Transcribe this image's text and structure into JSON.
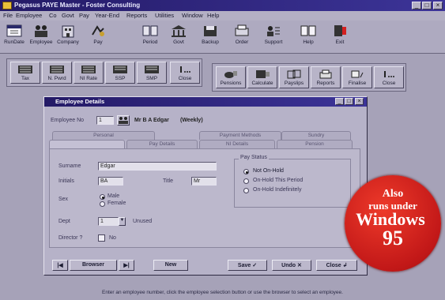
{
  "window": {
    "title": "Pegasus PAYE Master - Foster Consulting"
  },
  "menu": [
    "File",
    "Employee",
    "Co",
    "Govt",
    "Pay",
    "Year-End",
    "Reports",
    "Utilities",
    "Window",
    "Help"
  ],
  "main_toolbar": [
    {
      "label": "RunDate",
      "icon": "calendar-icon"
    },
    {
      "label": "Employee",
      "icon": "people-icon"
    },
    {
      "label": "Company",
      "icon": "company-icon"
    },
    {
      "label": "Pay",
      "icon": "pay-icon"
    },
    {
      "label": "Period",
      "icon": "period-icon"
    },
    {
      "label": "Govt",
      "icon": "govt-icon"
    },
    {
      "label": "Backup",
      "icon": "backup-icon"
    },
    {
      "label": "Order",
      "icon": "order-icon"
    },
    {
      "label": "Support",
      "icon": "support-icon"
    },
    {
      "label": "Help",
      "icon": "help-icon"
    },
    {
      "label": "Exit",
      "icon": "exit-icon"
    }
  ],
  "toolbar_left": [
    {
      "label": "Tax",
      "icon": "tax-icon"
    },
    {
      "label": "N. Pwrd",
      "icon": "ni-icon"
    },
    {
      "label": "NI Rate",
      "icon": "ni-rate-icon"
    },
    {
      "label": "SSP",
      "icon": "ssp-icon"
    },
    {
      "label": "SMP",
      "icon": "smp-icon"
    },
    {
      "label": "Close",
      "icon": "close-group-icon"
    }
  ],
  "toolbar_right": [
    {
      "label": "Pensions",
      "icon": "pensions-icon"
    },
    {
      "label": "Calculate",
      "icon": "calculate-icon"
    },
    {
      "label": "Payslips",
      "icon": "payslips-icon"
    },
    {
      "label": "Reports",
      "icon": "reports-icon"
    },
    {
      "label": "Finalise",
      "icon": "finalise-icon"
    },
    {
      "label": "Close",
      "icon": "close-group-icon"
    }
  ],
  "employee_details": {
    "title": "Employee Details",
    "employee_no_label": "Employee No",
    "employee_no_value": "1",
    "employee_name": "Mr B A Edgar",
    "employee_status": "(Weekly)",
    "tabs_back": [
      "Personal",
      "Payment Methods",
      "Sundry"
    ],
    "tabs_front": [
      "",
      "Pay Details",
      "NI Details",
      "Pension"
    ],
    "surname_label": "Surname",
    "surname_value": "Edgar",
    "initials_label": "Initials",
    "initials_value": "BA",
    "title_label": "Title",
    "title_value": "Mr",
    "sex_label": "Sex",
    "sex_options": [
      "Male",
      "Female"
    ],
    "sex_selected": "Male",
    "dept_label": "Dept",
    "dept_value": "1",
    "dept_name": "Unused",
    "director_label": "Director ?",
    "director_value": "No",
    "pay_status_label": "Pay Status",
    "pay_status_options": [
      "Not On-Hold",
      "On-Hold This Period",
      "On-Hold Indefinitely"
    ],
    "pay_status_selected": "Not On-Hold",
    "browser_label": "Browser",
    "new_label": "New",
    "save_label": "Save",
    "undo_label": "Undo",
    "close_label": "Close"
  },
  "status_text": "Enter an employee number, click the employee selection button or use the browser to select an employee.",
  "promo": {
    "line1": "Also",
    "line2": "runs under",
    "line3": "Windows",
    "line4": "95"
  },
  "colors": {
    "titlebar": "#241a66",
    "face": "#b4b0c4",
    "badge": "#d42020"
  }
}
